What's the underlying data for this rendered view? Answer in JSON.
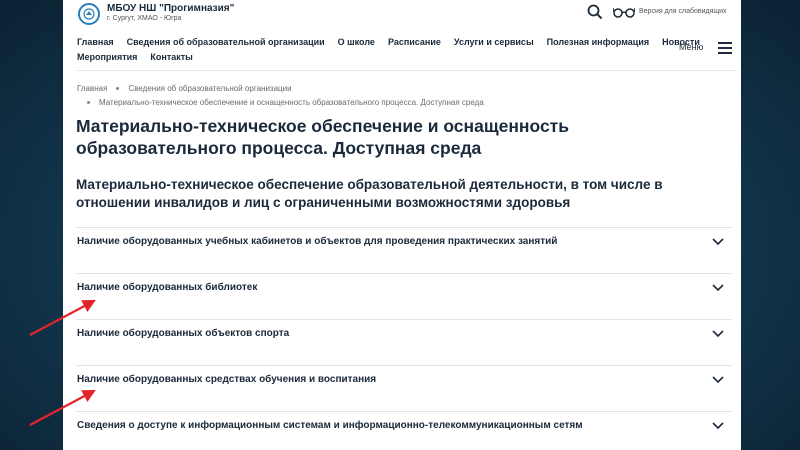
{
  "header": {
    "org_name": "МБОУ НШ \"Прогимназия\"",
    "org_location": "г. Сургут, ХМАО - Югра",
    "accessibility_label": "Версия для слабовидящих",
    "menu_label": "Меню"
  },
  "nav": {
    "row1": [
      "Главная",
      "Сведения об образовательной организации",
      "О школе",
      "Расписание",
      "Услуги и сервисы",
      "Полезная информация",
      "Новости"
    ],
    "row2": [
      "Мероприятия",
      "Контакты"
    ]
  },
  "breadcrumb": {
    "home": "Главная",
    "section": "Сведения об образовательной организации",
    "current": "Материально-техническое обеспечение и оснащенность образовательного процесса. Доступная среда"
  },
  "page_title": "Материально-техническое обеспечение и оснащенность образовательного процесса. Доступная среда",
  "section_heading": "Материально-техническое обеспечение образовательной деятельности, в том числе в отношении инвалидов и лиц с ограниченными возможностями здоровья",
  "accordion": [
    {
      "label": "Наличие оборудованных учебных кабинетов и объектов для проведения практических занятий"
    },
    {
      "label": "Наличие оборудованных библиотек"
    },
    {
      "label": "Наличие оборудованных объектов спорта"
    },
    {
      "label": "Наличие оборудованных средствах обучения и воспитания"
    },
    {
      "label": "Сведения о доступе к информационным системам и информационно-телекоммуникационным сетям"
    }
  ],
  "icons": {
    "logo": "school-logo-icon",
    "search": "search-icon",
    "accessibility": "glasses-icon",
    "menu": "hamburger-menu-icon",
    "expand": "chevron-down-icon",
    "annotation": "red-arrow-icon"
  },
  "colors": {
    "background": "#143a52",
    "text": "#1b2a3a",
    "annotation_arrow": "#e0262a",
    "logo_accent": "#2b7fb8"
  }
}
